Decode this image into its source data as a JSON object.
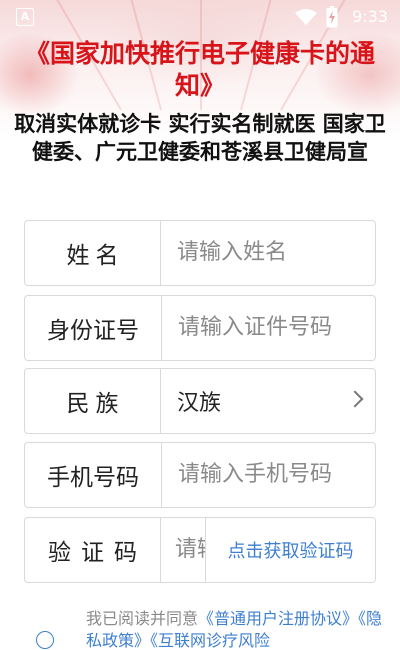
{
  "status_bar": {
    "left_icon": "A",
    "left_icon_name": "notification-app-icon",
    "icons": [
      "wifi-icon",
      "battery-charging-icon"
    ],
    "time": "9:33"
  },
  "banner": {
    "title": "《国家加快推行电子健康卡的通知》",
    "subtitle": "取消实体就诊卡 实行实名制就医 国家卫健委、广元卫健委和苍溪县卫健局宣"
  },
  "form": {
    "name": {
      "label": "姓名",
      "placeholder": "请输入姓名"
    },
    "id_number": {
      "label": "身份证号",
      "placeholder": "请输入证件号码"
    },
    "ethnicity": {
      "label": "民族",
      "value": "汉族"
    },
    "phone": {
      "label": "手机号码",
      "placeholder": "请输入手机号码"
    },
    "verify_code": {
      "label": "验证码",
      "placeholder": "请输入验证码",
      "button_label": "点击获取验证码"
    }
  },
  "agreement": {
    "prefix": "我已阅读并同意",
    "links": [
      "《普通用户注册协议》",
      "《隐私政策》",
      "《互联网诊疗风险"
    ]
  },
  "colors": {
    "headline": "#d8141b",
    "accent": "#3e7fd0",
    "border": "#d9d9d9"
  }
}
